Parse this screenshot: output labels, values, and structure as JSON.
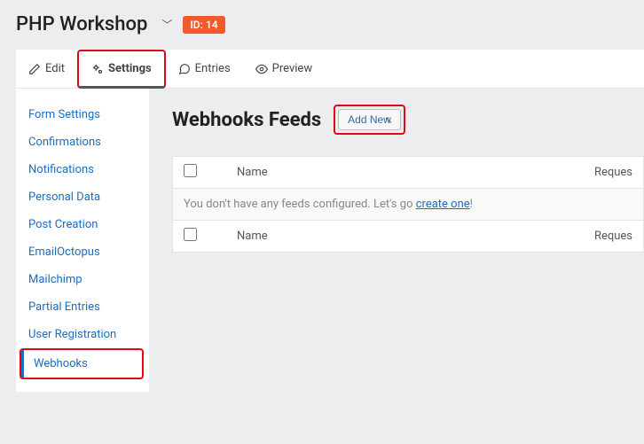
{
  "header": {
    "title": "PHP Workshop",
    "id_label": "ID: 14"
  },
  "tabs": [
    {
      "label": "Edit"
    },
    {
      "label": "Settings"
    },
    {
      "label": "Entries"
    },
    {
      "label": "Preview"
    }
  ],
  "sidebar": {
    "items": [
      {
        "label": "Form Settings"
      },
      {
        "label": "Confirmations"
      },
      {
        "label": "Notifications"
      },
      {
        "label": "Personal Data"
      },
      {
        "label": "Post Creation"
      },
      {
        "label": "EmailOctopus"
      },
      {
        "label": "Mailchimp"
      },
      {
        "label": "Partial Entries"
      },
      {
        "label": "User Registration"
      },
      {
        "label": "Webhooks"
      }
    ]
  },
  "main": {
    "title": "Webhooks Feeds",
    "add_new": "Add New",
    "col_name": "Name",
    "col_request": "Reques",
    "empty_prefix": "You don't have any feeds configured. Let's go ",
    "empty_link": "create one",
    "empty_suffix": "!"
  }
}
